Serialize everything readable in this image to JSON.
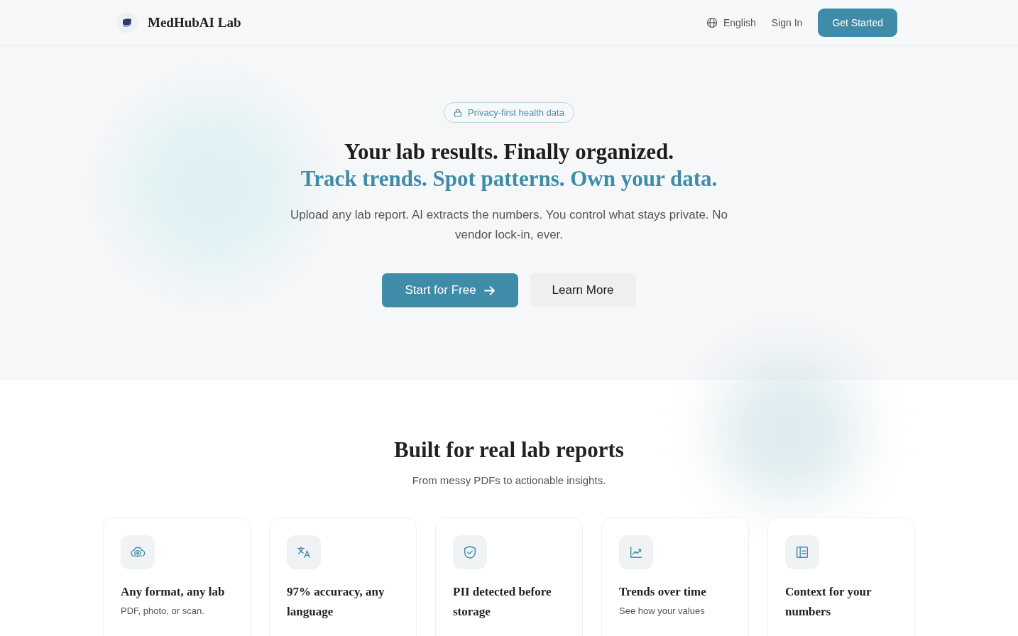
{
  "header": {
    "brand": "MedHubAI Lab",
    "language": "English",
    "sign_in": "Sign In",
    "cta": "Get Started"
  },
  "hero": {
    "badge": "Privacy-first health data",
    "title": "Your lab results. Finally organized.",
    "subtitle": "Track trends. Spot patterns. Own your data.",
    "description": "Upload any lab report. AI extracts the numbers. You control what stays private. No vendor lock-in, ever.",
    "primary_button": "Start for Free",
    "secondary_button": "Learn More"
  },
  "features": {
    "title": "Built for real lab reports",
    "subtitle": "From messy PDFs to actionable insights.",
    "cards": [
      {
        "kind": "upload",
        "title": "Any format, any lab",
        "description": "PDF, photo, or scan."
      },
      {
        "kind": "translate",
        "title": "97% accuracy, any language"
      },
      {
        "kind": "shield",
        "title": "PII detected before storage"
      },
      {
        "kind": "chart",
        "title": "Trends over time",
        "description": "See how your values"
      },
      {
        "kind": "book",
        "title": "Context for your numbers"
      }
    ]
  }
}
